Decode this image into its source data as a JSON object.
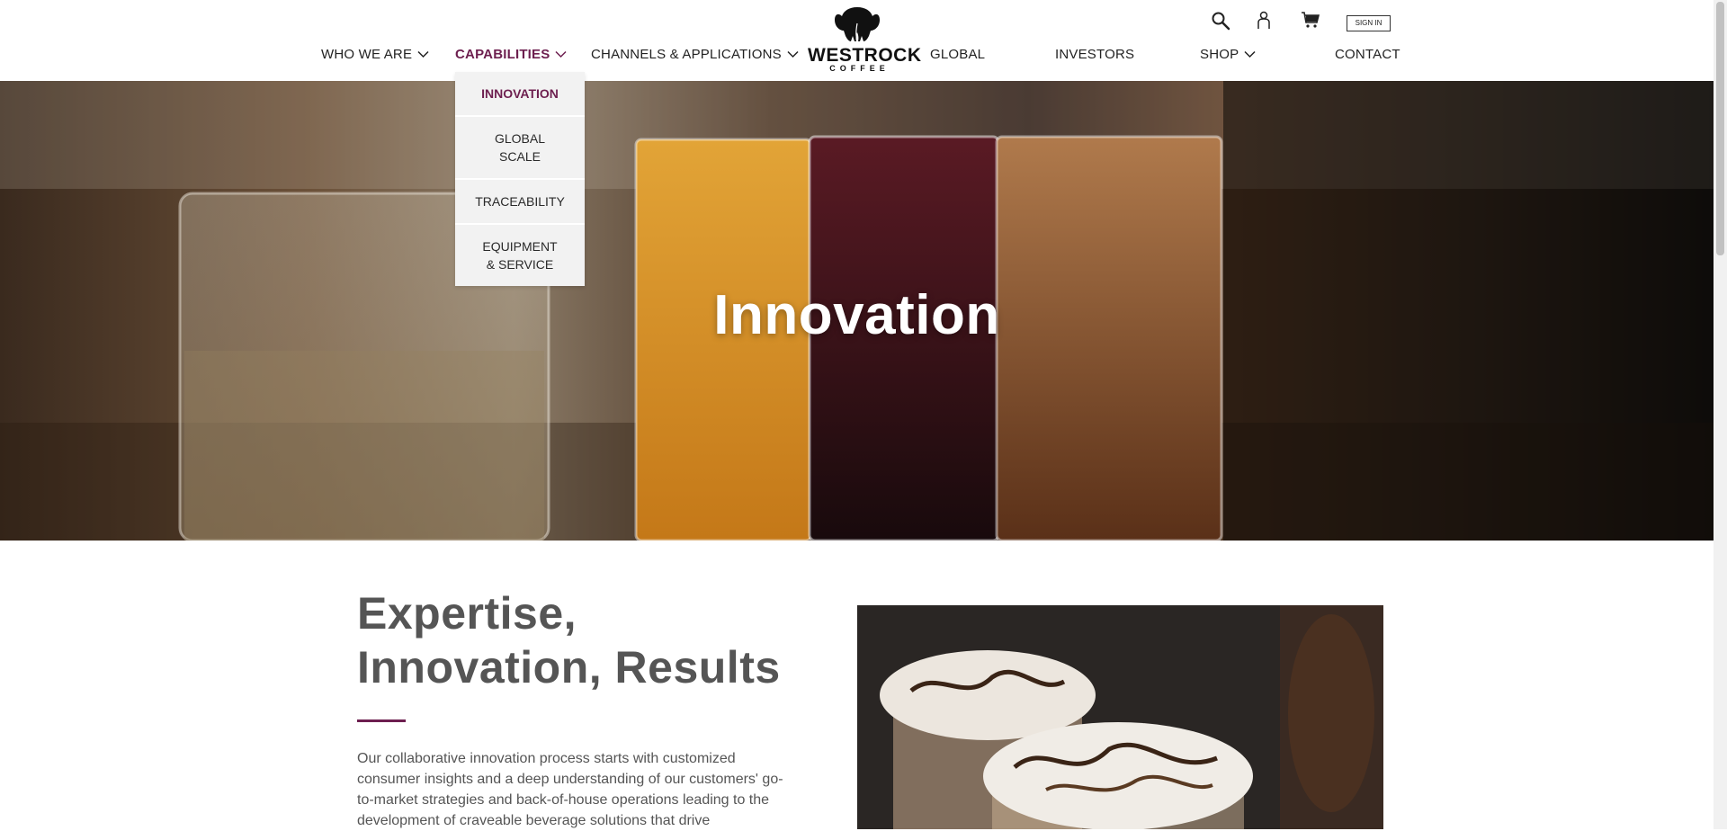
{
  "header": {
    "logo": {
      "word": "WESTROCK",
      "sub": "COFFEE"
    },
    "nav": [
      {
        "label": "WHO WE ARE",
        "has_dropdown": true
      },
      {
        "label": "CAPABILITIES",
        "has_dropdown": true,
        "active": true
      },
      {
        "label": "CHANNELS & APPLICATIONS",
        "has_dropdown": true
      },
      {
        "label": "GLOBAL",
        "has_dropdown": false
      },
      {
        "label": "INVESTORS",
        "has_dropdown": false
      },
      {
        "label": "SHOP",
        "has_dropdown": true
      },
      {
        "label": "CONTACT",
        "has_dropdown": false
      }
    ],
    "utility": {
      "search_icon": "search-icon",
      "user_icon": "user-icon",
      "cart_icon": "cart-icon",
      "signin_label": "SIGN IN"
    }
  },
  "capabilities_menu": {
    "items": [
      {
        "label": "INNOVATION",
        "active": true
      },
      {
        "label": "GLOBAL SCALE"
      },
      {
        "label": "TRACEABILITY"
      },
      {
        "label": "EQUIPMENT & SERVICE"
      }
    ]
  },
  "hero": {
    "title": "Innovation"
  },
  "main": {
    "title": "Expertise, Innovation, Results",
    "body": "Our collaborative innovation process starts with customized consumer insights and a deep understanding of our customers' go-to-market strategies and back-of-house operations leading to the development of craveable beverage solutions that drive"
  },
  "colors": {
    "accent": "#6d1f4f",
    "heading_gray": "#555555",
    "menu_bg": "#f2f2f2"
  }
}
